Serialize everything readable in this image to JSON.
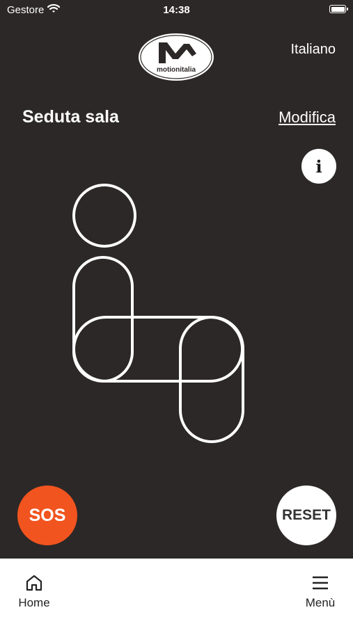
{
  "status_bar": {
    "carrier": "Gestore",
    "time": "14:38"
  },
  "header": {
    "logo_text": "motionitalia",
    "language": "Italiano"
  },
  "section": {
    "title": "Seduta sala",
    "edit_label": "Modifica"
  },
  "info_button": {
    "label": "i",
    "icon": "info-icon"
  },
  "actions": {
    "sos_label": "SOS",
    "reset_label": "RESET"
  },
  "tab_bar": {
    "home_label": "Home",
    "menu_label": "Menù"
  },
  "colors": {
    "background": "#2c2827",
    "sos": "#f2541f",
    "reset": "#ffffff",
    "tab_bar": "#ffffff"
  }
}
